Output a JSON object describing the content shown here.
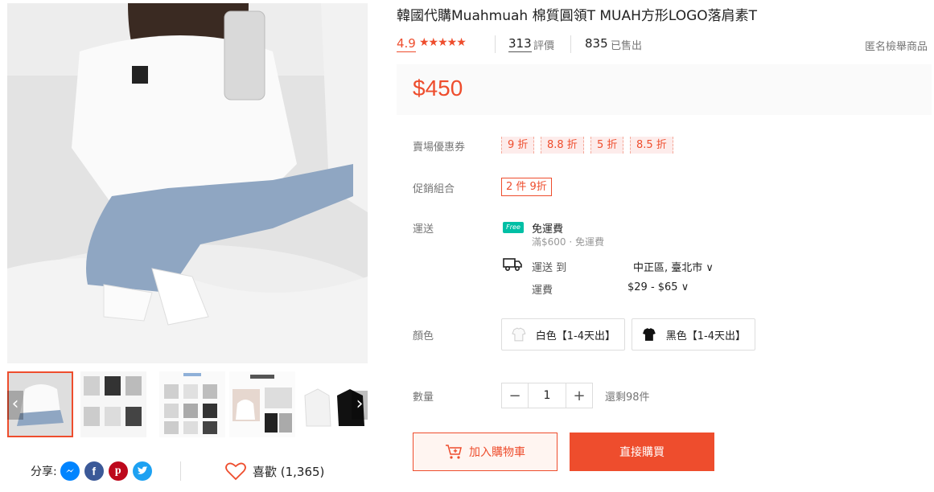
{
  "product": {
    "title": "韓國代購Muahmuah 棉質圓領T MUAH方形LOGO落肩素T",
    "rating": "4.9",
    "stars": "★★★★★",
    "reviews_count": "313",
    "reviews_label": "評價",
    "sold_count": "835",
    "sold_label": "已售出",
    "report_label": "匿名檢舉商品",
    "price": "$450"
  },
  "vouchers": {
    "label": "賣場優惠券",
    "items": [
      "9 折",
      "8.8 折",
      "5 折",
      "8.5 折"
    ]
  },
  "combo": {
    "label": "促銷組合",
    "value": "2 件 9折"
  },
  "shipping": {
    "label": "運送",
    "free_badge": "Free",
    "free_title": "免運費",
    "free_condition": "滿$600 · 免運費",
    "ship_to_label": "運送 到",
    "ship_to_value": "中正區, 臺北市 ∨",
    "fee_label": "運費",
    "fee_value": "$29 - $65 ∨"
  },
  "colors": {
    "label": "顏色",
    "options": [
      {
        "name": "白色【1-4天出】",
        "swatch": "#ffffff"
      },
      {
        "name": "黑色【1-4天出】",
        "swatch": "#111111"
      }
    ]
  },
  "quantity": {
    "label": "數量",
    "minus": "−",
    "value": "1",
    "plus": "+",
    "stock": "還剩98件"
  },
  "actions": {
    "add_to_cart": "加入購物車",
    "buy_now": "直接購買"
  },
  "media": {
    "prev_arrow": "‹",
    "next_arrow": "›"
  },
  "share": {
    "label": "分享:",
    "likes": "喜歡 (1,365)"
  },
  "theme": {
    "accent": "#ee4d2d",
    "free_shipping": "#00bfa5",
    "messenger": "#0084ff",
    "facebook": "#3b5998",
    "pinterest": "#bd081c",
    "twitter": "#1da1f2"
  }
}
